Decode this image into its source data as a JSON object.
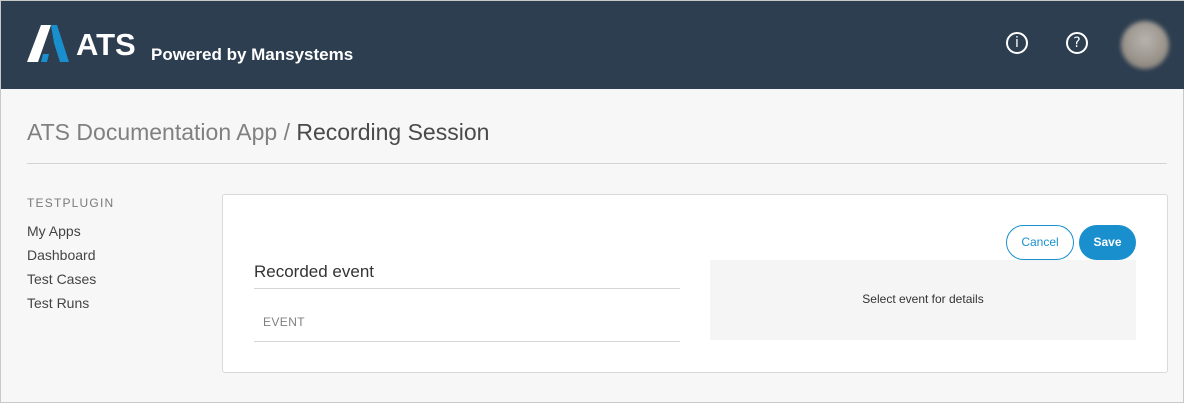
{
  "header": {
    "brand": "ATS",
    "tagline": "Powered by Mansystems",
    "icons": [
      "info-icon",
      "help-icon"
    ],
    "colors": {
      "bar": "#2d3e50",
      "logo_accent": "#1a8fce"
    }
  },
  "breadcrumb": {
    "app": "ATS Documentation App",
    "separator": "/",
    "current": "Recording Session"
  },
  "sidebar": {
    "heading": "TESTPLUGIN",
    "items": [
      {
        "label": "My Apps"
      },
      {
        "label": "Dashboard"
      },
      {
        "label": "Test Cases"
      },
      {
        "label": "Test Runs"
      }
    ]
  },
  "main": {
    "cancel_label": "Cancel",
    "save_label": "Save",
    "recorded_title": "Recorded event",
    "table": {
      "columns": [
        "EVENT"
      ],
      "rows": []
    },
    "detail_placeholder": "Select event for details"
  }
}
